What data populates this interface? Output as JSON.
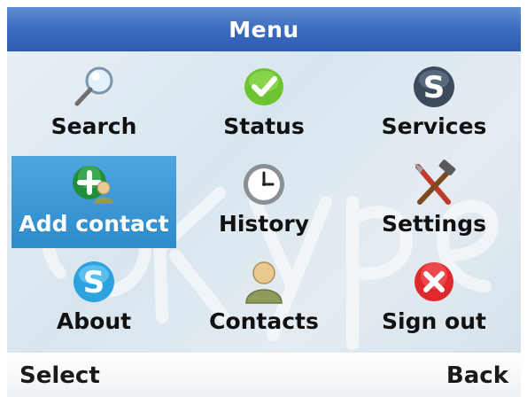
{
  "header": {
    "title": "Menu"
  },
  "menu": {
    "selected_index": 3,
    "items": [
      {
        "label": "Search",
        "icon": "magnifier-icon"
      },
      {
        "label": "Status",
        "icon": "status-check-icon"
      },
      {
        "label": "Services",
        "icon": "skype-dark-icon"
      },
      {
        "label": "Add contact",
        "icon": "add-contact-icon"
      },
      {
        "label": "History",
        "icon": "clock-icon"
      },
      {
        "label": "Settings",
        "icon": "tools-icon"
      },
      {
        "label": "About",
        "icon": "skype-icon"
      },
      {
        "label": "Contacts",
        "icon": "contact-person-icon"
      },
      {
        "label": "Sign out",
        "icon": "sign-out-icon"
      }
    ]
  },
  "softkeys": {
    "left": "Select",
    "right": "Back"
  },
  "colors": {
    "title_bar": "#3b6cc0",
    "selection": "#2d8acb",
    "background": "#dde7ef"
  }
}
